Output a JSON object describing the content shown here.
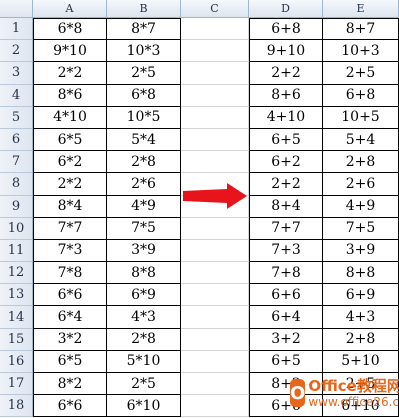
{
  "columns": [
    "A",
    "B",
    "C",
    "D",
    "E"
  ],
  "row_numbers": [
    "1",
    "2",
    "3",
    "4",
    "5",
    "6",
    "7",
    "8",
    "9",
    "10",
    "11",
    "12",
    "13",
    "14",
    "15",
    "16",
    "17",
    "18"
  ],
  "rows": [
    {
      "a": "6*8",
      "b": "8*7",
      "d": "6+8",
      "e": "8+7"
    },
    {
      "a": "9*10",
      "b": "10*3",
      "d": "9+10",
      "e": "10+3"
    },
    {
      "a": "2*2",
      "b": "2*5",
      "d": "2+2",
      "e": "2+5"
    },
    {
      "a": "8*6",
      "b": "6*8",
      "d": "8+6",
      "e": "6+8"
    },
    {
      "a": "4*10",
      "b": "10*5",
      "d": "4+10",
      "e": "10+5"
    },
    {
      "a": "6*5",
      "b": "5*4",
      "d": "6+5",
      "e": "5+4"
    },
    {
      "a": "6*2",
      "b": "2*8",
      "d": "6+2",
      "e": "2+8"
    },
    {
      "a": "2*2",
      "b": "2*6",
      "d": "2+2",
      "e": "2+6"
    },
    {
      "a": "8*4",
      "b": "4*9",
      "d": "8+4",
      "e": "4+9"
    },
    {
      "a": "7*7",
      "b": "7*5",
      "d": "7+7",
      "e": "7+5"
    },
    {
      "a": "7*3",
      "b": "3*9",
      "d": "7+3",
      "e": "3+9"
    },
    {
      "a": "7*8",
      "b": "8*8",
      "d": "7+8",
      "e": "8+8"
    },
    {
      "a": "6*6",
      "b": "6*9",
      "d": "6+6",
      "e": "6+9"
    },
    {
      "a": "6*4",
      "b": "4*3",
      "d": "6+4",
      "e": "4+3"
    },
    {
      "a": "3*2",
      "b": "2*8",
      "d": "3+2",
      "e": "2+8"
    },
    {
      "a": "6*5",
      "b": "5*10",
      "d": "6+5",
      "e": "5+10"
    },
    {
      "a": "8*2",
      "b": "2*5",
      "d": "8+2",
      "e": "2+5"
    },
    {
      "a": "6*6",
      "b": "6*10",
      "d": "6+6",
      "e": "6+10"
    }
  ],
  "colors": {
    "arrow": "#e8141b",
    "watermark": "#e8661a"
  },
  "watermark": {
    "title": "Office教程网",
    "url": "www.office26.com"
  }
}
